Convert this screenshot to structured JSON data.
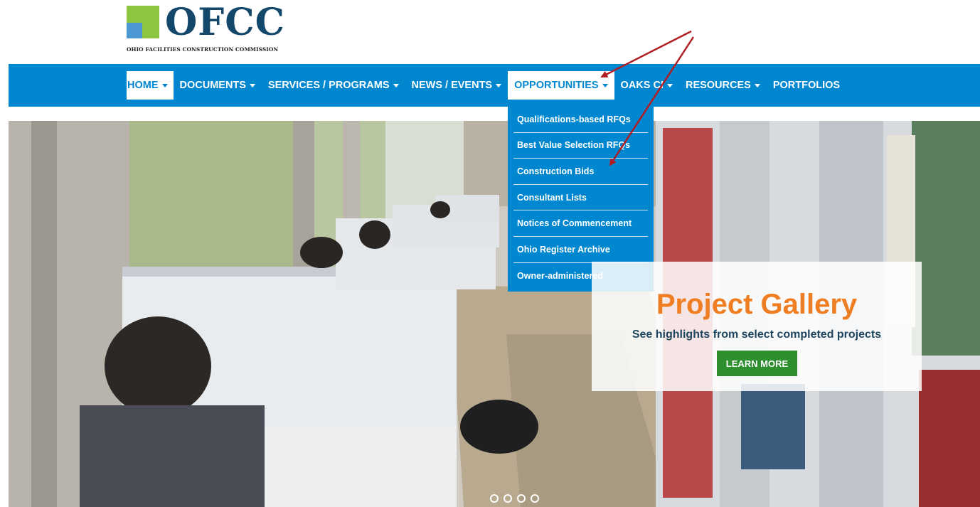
{
  "logo": {
    "wordmark": "OFCC",
    "subtitle": "OHIO FACILITIES CONSTRUCTION COMMISSION"
  },
  "nav": {
    "items": [
      {
        "label": "HOME",
        "state": "active"
      },
      {
        "label": "DOCUMENTS",
        "state": ""
      },
      {
        "label": "SERVICES / PROGRAMS",
        "state": ""
      },
      {
        "label": "NEWS / EVENTS",
        "state": ""
      },
      {
        "label": "OPPORTUNITIES",
        "state": "open"
      },
      {
        "label": "OAKS CI",
        "state": ""
      },
      {
        "label": "RESOURCES",
        "state": ""
      },
      {
        "label": "PORTFOLIOS",
        "state": ""
      }
    ]
  },
  "dropdown": {
    "items": [
      "Qualifications-based RFQs",
      "Best Value Selection RFQs",
      "Construction Bids",
      "Consultant Lists",
      "Notices of Commencement",
      "Ohio Register Archive",
      "Owner-administered"
    ]
  },
  "hero": {
    "title": "Project Gallery",
    "subtitle": "See highlights from select completed projects",
    "button": "LEARN MORE",
    "slide_count": 4
  },
  "colors": {
    "nav_blue": "#0087cf",
    "logo_navy": "#14486b",
    "logo_green": "#8dc63f",
    "logo_blue": "#4b97d2",
    "title_orange": "#ef7d22",
    "button_green": "#2d8f2e",
    "arrow_red": "#b01e24"
  }
}
